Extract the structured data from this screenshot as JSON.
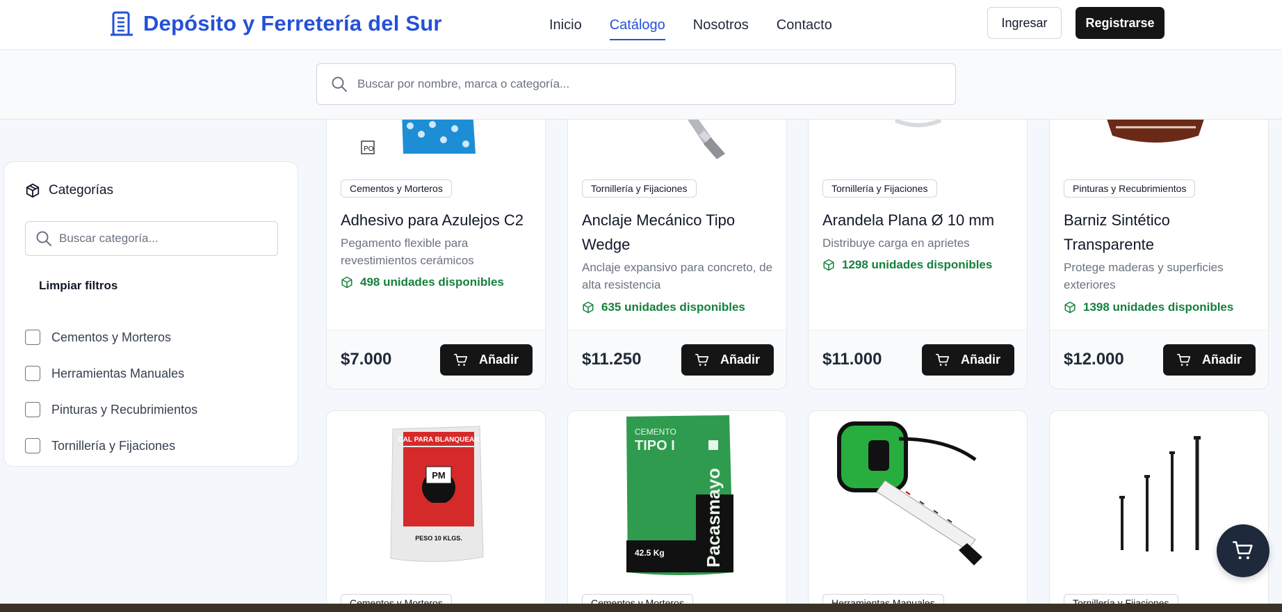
{
  "header": {
    "brand": "Depósito y Ferretería del Sur",
    "nav": [
      "Inicio",
      "Catálogo",
      "Nosotros",
      "Contacto"
    ],
    "active_nav": "Catálogo",
    "login": "Ingresar",
    "register": "Registrarse"
  },
  "search": {
    "placeholder": "Buscar por nombre, marca o categoría..."
  },
  "sidebar": {
    "title": "Categorías",
    "search_placeholder": "Buscar categoría...",
    "clear": "Limpiar filtros",
    "categories": [
      "Cementos y Morteros",
      "Herramientas Manuales",
      "Pinturas y Recubrimientos",
      "Tornillería y Fijaciones"
    ]
  },
  "add_label": "Añadir",
  "products_row1": [
    {
      "category": "Cementos y Morteros",
      "title": "Adhesivo para Azulejos C2",
      "description": "Pegamento flexible para revestimientos cerámicos",
      "stock": "498 unidades disponibles",
      "price": "$7.000"
    },
    {
      "category": "Tornillería y Fijaciones",
      "title": "Anclaje Mecánico Tipo Wedge",
      "description": "Anclaje expansivo para concreto, de alta resistencia",
      "stock": "635 unidades disponibles",
      "price": "$11.250"
    },
    {
      "category": "Tornillería y Fijaciones",
      "title": "Arandela Plana Ø 10 mm",
      "description": "Distribuye carga en aprietes",
      "stock": "1298 unidades disponibles",
      "price": "$11.000"
    },
    {
      "category": "Pinturas y Recubrimientos",
      "title": "Barniz Sintético Transparente",
      "description": "Protege maderas y superficies exteriores",
      "stock": "1398 unidades disponibles",
      "price": "$12.000"
    }
  ],
  "products_row2": [
    {
      "category": "Cementos y Morteros",
      "image_text": [
        "CAL PARA BLANQUEAR",
        "PM",
        "PESO 10 KLGS."
      ]
    },
    {
      "category": "Cementos y Morteros",
      "image_text": [
        "CEMENTO",
        "TIPO I",
        "Pacasmayo",
        "42.5 Kg"
      ]
    },
    {
      "category": "Herramientas Manuales"
    },
    {
      "category": "Tornillería y Fijaciones"
    }
  ],
  "colors": {
    "brand": "#2451d6",
    "dark_button": "#151515",
    "stock_green": "#15803d",
    "fab": "#1e2a3b"
  }
}
